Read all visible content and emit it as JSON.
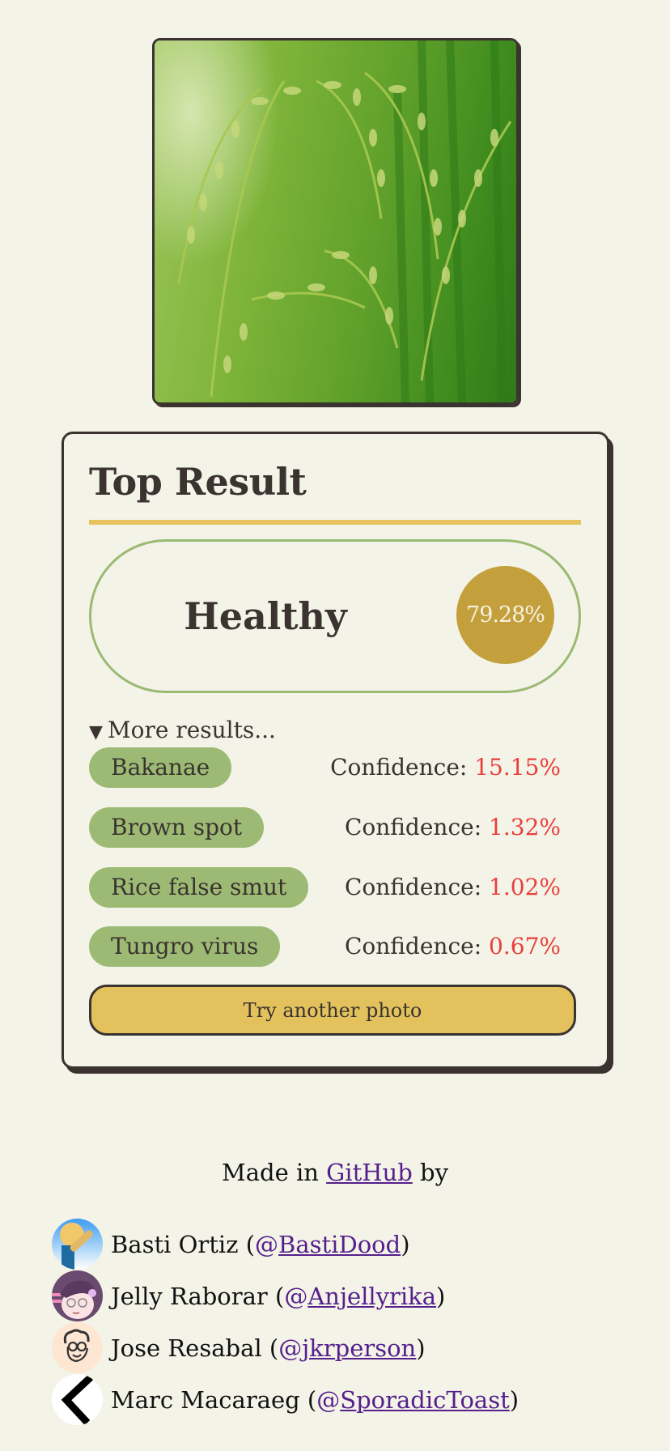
{
  "photo": {
    "alt": "Uploaded rice plant photo",
    "subject": "rice-panicles-image"
  },
  "card": {
    "title": "Top Result",
    "top_result": {
      "label": "Healthy",
      "confidence": "79.28%"
    },
    "more_results_label": "More results...",
    "confidence_prefix": "Confidence:",
    "results": [
      {
        "label": "Bakanae",
        "confidence": "15.15%"
      },
      {
        "label": "Brown spot",
        "confidence": "1.32%"
      },
      {
        "label": "Rice false smut",
        "confidence": "1.02%"
      },
      {
        "label": "Tungro virus",
        "confidence": "0.67%"
      }
    ],
    "retry_label": "Try another photo"
  },
  "footer": {
    "made_prefix": "Made in ",
    "made_link": "GitHub",
    "made_suffix": " by",
    "contributors": [
      {
        "name": "Basti Ortiz",
        "handle": "BastiDood",
        "avatar": "basti-avatar"
      },
      {
        "name": "Jelly Raborar",
        "handle": "Anjellyrika",
        "avatar": "jelly-avatar"
      },
      {
        "name": "Jose Resabal",
        "handle": "jkrperson",
        "avatar": "jose-avatar"
      },
      {
        "name": "Marc Macaraeg",
        "handle": "SporadicToast",
        "avatar": "marc-avatar"
      }
    ]
  },
  "colors": {
    "background": "#f4f3e8",
    "ink": "#3a3330",
    "accent_yellow": "#e6c35e",
    "pill_green": "#9dba74",
    "badge_gold": "#c4a03c",
    "confidence_red": "#e8403a",
    "link_purple": "#55208c"
  }
}
